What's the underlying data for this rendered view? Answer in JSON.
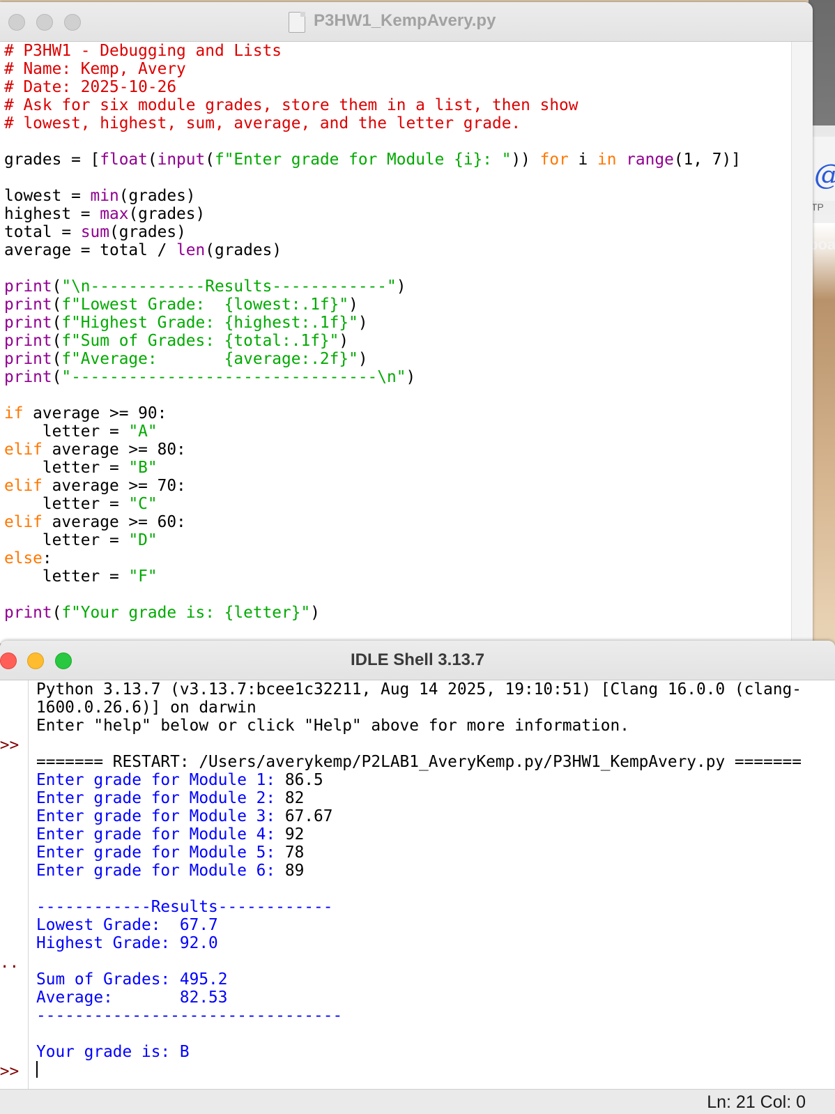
{
  "desktop": {
    "icon_text": "@",
    "icon_caption": "TP",
    "side_text": "boa"
  },
  "editor": {
    "title": "P3HW1_KempAvery.py",
    "lines": [
      [
        [
          "c-com",
          "# P3HW1 - Debugging and Lists"
        ]
      ],
      [
        [
          "c-com",
          "# Name: Kemp, Avery"
        ]
      ],
      [
        [
          "c-com",
          "# Date: 2025-10-26"
        ]
      ],
      [
        [
          "c-com",
          "# Ask for six module grades, store them in a list, then show"
        ]
      ],
      [
        [
          "c-com",
          "# lowest, highest, sum, average, and the letter grade."
        ]
      ],
      [],
      [
        [
          "",
          "grades = ["
        ],
        [
          "c-bi",
          "float"
        ],
        [
          "",
          "("
        ],
        [
          "c-bi",
          "input"
        ],
        [
          "",
          "("
        ],
        [
          "c-str",
          "f\"Enter grade for Module {i}: \""
        ],
        [
          "",
          ")) "
        ],
        [
          "c-kw",
          "for"
        ],
        [
          "",
          " i "
        ],
        [
          "c-kw",
          "in"
        ],
        [
          "",
          " "
        ],
        [
          "c-bi",
          "range"
        ],
        [
          "",
          "(1, 7)]"
        ]
      ],
      [],
      [
        [
          "",
          "lowest = "
        ],
        [
          "c-bi",
          "min"
        ],
        [
          "",
          "(grades)"
        ]
      ],
      [
        [
          "",
          "highest = "
        ],
        [
          "c-bi",
          "max"
        ],
        [
          "",
          "(grades)"
        ]
      ],
      [
        [
          "",
          "total = "
        ],
        [
          "c-bi",
          "sum"
        ],
        [
          "",
          "(grades)"
        ]
      ],
      [
        [
          "",
          "average = total / "
        ],
        [
          "c-bi",
          "len"
        ],
        [
          "",
          "(grades)"
        ]
      ],
      [],
      [
        [
          "c-bi",
          "print"
        ],
        [
          "",
          "("
        ],
        [
          "c-str",
          "\"\\n------------Results------------\""
        ],
        [
          "",
          ")"
        ]
      ],
      [
        [
          "c-bi",
          "print"
        ],
        [
          "",
          "("
        ],
        [
          "c-str",
          "f\"Lowest Grade:  {lowest:.1f}\""
        ],
        [
          "",
          ")"
        ]
      ],
      [
        [
          "c-bi",
          "print"
        ],
        [
          "",
          "("
        ],
        [
          "c-str",
          "f\"Highest Grade: {highest:.1f}\""
        ],
        [
          "",
          ")"
        ]
      ],
      [
        [
          "c-bi",
          "print"
        ],
        [
          "",
          "("
        ],
        [
          "c-str",
          "f\"Sum of Grades: {total:.1f}\""
        ],
        [
          "",
          ")"
        ]
      ],
      [
        [
          "c-bi",
          "print"
        ],
        [
          "",
          "("
        ],
        [
          "c-str",
          "f\"Average:       {average:.2f}\""
        ],
        [
          "",
          ")"
        ]
      ],
      [
        [
          "c-bi",
          "print"
        ],
        [
          "",
          "("
        ],
        [
          "c-str",
          "\"--------------------------------\\n\""
        ],
        [
          "",
          ")"
        ]
      ],
      [],
      [
        [
          "c-kw",
          "if"
        ],
        [
          "",
          " average >= 90:"
        ]
      ],
      [
        [
          "",
          "    letter = "
        ],
        [
          "c-str",
          "\"A\""
        ]
      ],
      [
        [
          "c-kw",
          "elif"
        ],
        [
          "",
          " average >= 80:"
        ]
      ],
      [
        [
          "",
          "    letter = "
        ],
        [
          "c-str",
          "\"B\""
        ]
      ],
      [
        [
          "c-kw",
          "elif"
        ],
        [
          "",
          " average >= 70:"
        ]
      ],
      [
        [
          "",
          "    letter = "
        ],
        [
          "c-str",
          "\"C\""
        ]
      ],
      [
        [
          "c-kw",
          "elif"
        ],
        [
          "",
          " average >= 60:"
        ]
      ],
      [
        [
          "",
          "    letter = "
        ],
        [
          "c-str",
          "\"D\""
        ]
      ],
      [
        [
          "c-kw",
          "else"
        ],
        [
          "",
          ":"
        ]
      ],
      [
        [
          "",
          "    letter = "
        ],
        [
          "c-str",
          "\"F\""
        ]
      ],
      [],
      [
        [
          "c-bi",
          "print"
        ],
        [
          "",
          "("
        ],
        [
          "c-str",
          "f\"Your grade is: {letter}\""
        ],
        [
          "",
          ")"
        ]
      ]
    ]
  },
  "shell": {
    "title": "IDLE Shell 3.13.7",
    "gutter": [
      {
        "line": 3,
        "text": ">>>"
      },
      {
        "line": 15,
        "text": "..."
      },
      {
        "line": 21,
        "text": ">>>"
      }
    ],
    "lines": [
      [
        [
          "",
          "Python 3.13.7 (v3.13.7:bcee1c32211, Aug 14 2025, 19:10:51) [Clang 16.0.0 (clang-"
        ]
      ],
      [
        [
          "",
          "1600.0.26.6)] on darwin"
        ]
      ],
      [
        [
          "",
          "Enter \"help\" below or click \"Help\" above for more information."
        ]
      ],
      [],
      [
        [
          "",
          "======= RESTART: /Users/averykemp/P2LAB1_AveryKemp.py/P3HW1_KempAvery.py ======="
        ]
      ],
      [
        [
          "s-out",
          "Enter grade for Module 1: "
        ],
        [
          "",
          "86.5"
        ]
      ],
      [
        [
          "s-out",
          "Enter grade for Module 2: "
        ],
        [
          "",
          "82"
        ]
      ],
      [
        [
          "s-out",
          "Enter grade for Module 3: "
        ],
        [
          "",
          "67.67"
        ]
      ],
      [
        [
          "s-out",
          "Enter grade for Module 4: "
        ],
        [
          "",
          "92"
        ]
      ],
      [
        [
          "s-out",
          "Enter grade for Module 5: "
        ],
        [
          "",
          "78"
        ]
      ],
      [
        [
          "s-out",
          "Enter grade for Module 6: "
        ],
        [
          "",
          "89"
        ]
      ],
      [],
      [
        [
          "s-out",
          "------------Results------------"
        ]
      ],
      [
        [
          "s-out",
          "Lowest Grade:  67.7"
        ]
      ],
      [
        [
          "s-out",
          "Highest Grade: 92.0"
        ]
      ],
      [],
      [
        [
          "s-out",
          "Sum of Grades: 495.2"
        ]
      ],
      [
        [
          "s-out",
          "Average:       82.53"
        ]
      ],
      [
        [
          "s-out",
          "--------------------------------"
        ]
      ],
      [],
      [
        [
          "s-out",
          "Your grade is: B"
        ]
      ],
      [
        [
          "cursor",
          ""
        ]
      ]
    ],
    "status": "Ln: 21  Col: 0"
  }
}
